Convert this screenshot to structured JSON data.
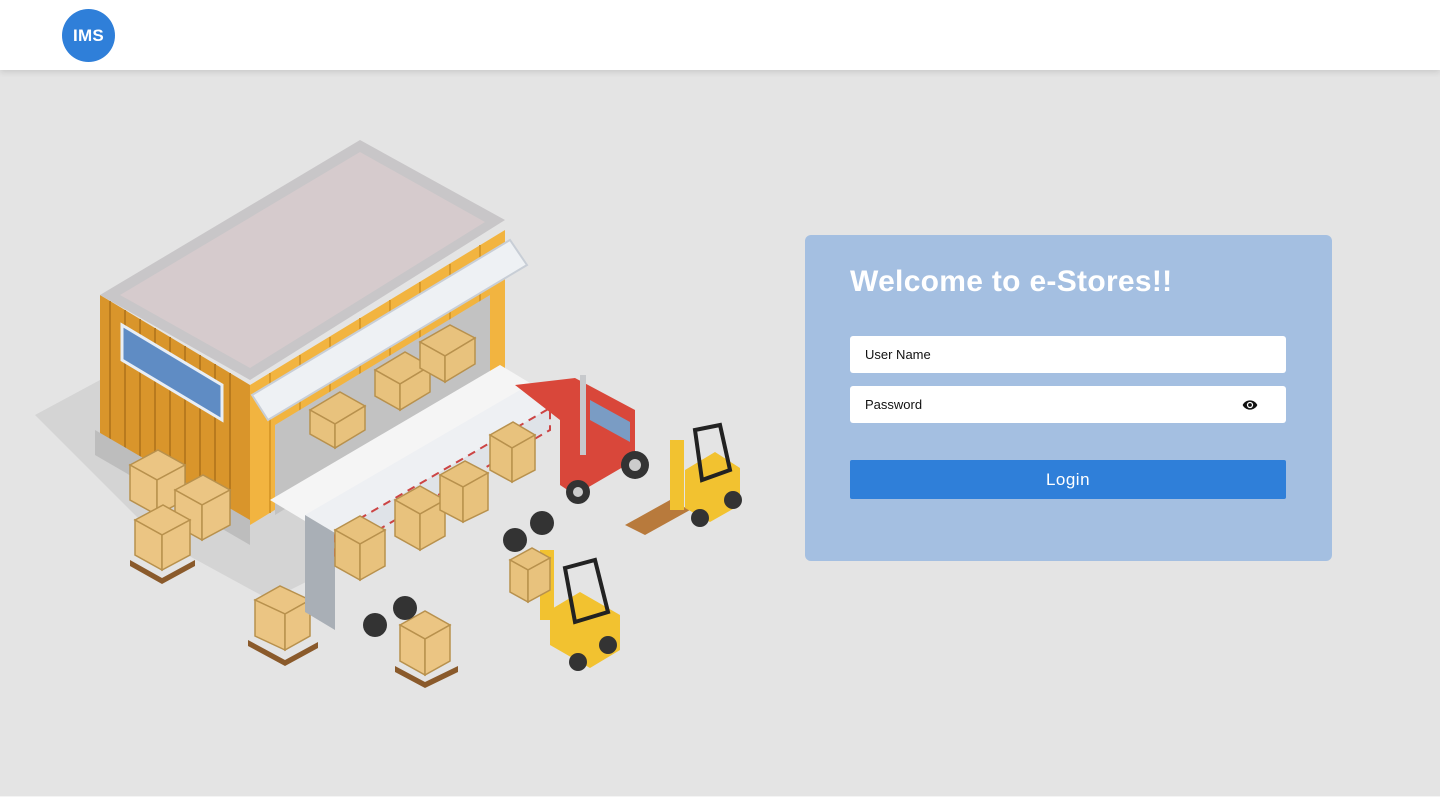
{
  "header": {
    "logo_text": "IMS",
    "logo_color": "#2f7fd9"
  },
  "illustration": {
    "subject": "warehouse-loading-dock-truck-forklifts"
  },
  "login": {
    "title": "Welcome to e-Stores!!",
    "username_placeholder": "User Name",
    "password_placeholder": "Password",
    "password_toggle_icon": "eye-icon",
    "submit_label": "Login",
    "panel_color": "#a4bfe1",
    "button_color": "#2f7fd9"
  }
}
